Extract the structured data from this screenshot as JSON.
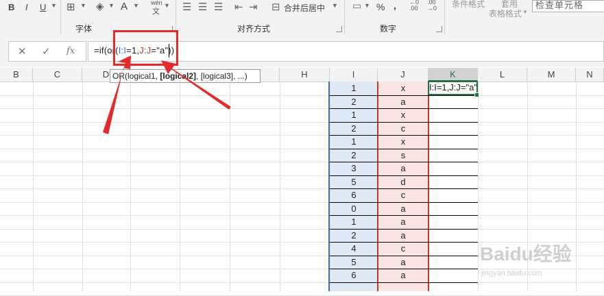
{
  "ribbon": {
    "font_buttons": [
      "B",
      "I",
      "U"
    ],
    "phonetic": {
      "top": "wén",
      "bottom": "文"
    },
    "font_color_glyph": "A",
    "percent": "%",
    "comma": ",",
    "dec_increase": "←0\n.00",
    "dec_decrease": ".00\n→0",
    "merge_center": "合并后居中",
    "conditional_format": "条件格式",
    "apply": "套用",
    "table_format": "表格格式",
    "check_cell": "检查单元格",
    "group_font": "字体",
    "group_alignment": "对齐方式",
    "group_number": "数字"
  },
  "formula_bar": {
    "cancel": "✕",
    "enter": "✓",
    "fx": "fx",
    "formula_prefix": "=if(or(",
    "ref_i": "I:I",
    "mid1": "=1,",
    "ref_j": "J:J",
    "mid2": "=\"a\"",
    "suffix": "))"
  },
  "tooltip": {
    "text_prefix": "OR(logical1, ",
    "bold_part": "[logical2]",
    "text_suffix": ", [logical3], ...)"
  },
  "columns": [
    "B",
    "C",
    "D",
    "E",
    "F",
    "G",
    "H",
    "I",
    "J",
    "K",
    "L",
    "M",
    "N"
  ],
  "selected_column": "K",
  "col_i_values": [
    "1",
    "2",
    "1",
    "2",
    "1",
    "2",
    "3",
    "5",
    "6",
    "0",
    "1",
    "2",
    "4",
    "5",
    "6"
  ],
  "col_j_values": [
    "x",
    "a",
    "x",
    "c",
    "x",
    "s",
    "a",
    "d",
    "c",
    "a",
    "a",
    "a",
    "c",
    "a",
    "a"
  ],
  "active_cell_text": "I:I=1,J:J=\"a\"",
  "watermark": {
    "brand": "Baidu经验",
    "url": "jingyan.baidu.com"
  }
}
